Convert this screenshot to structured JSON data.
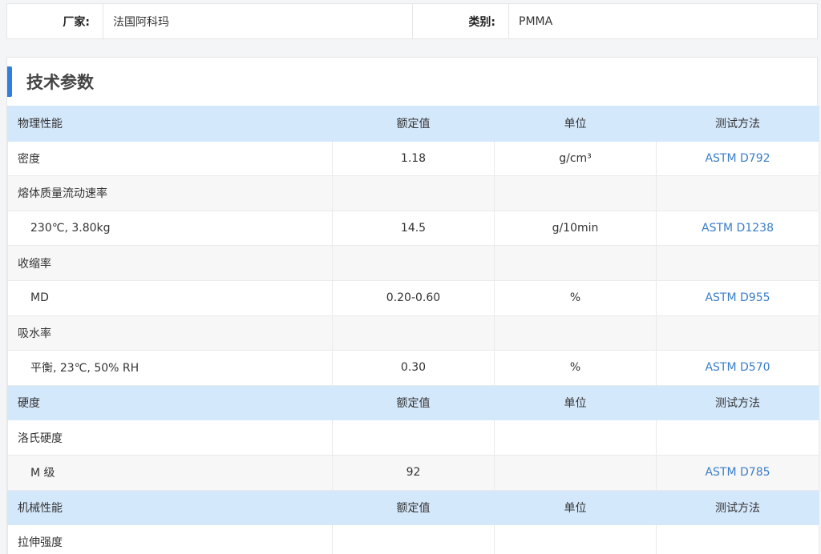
{
  "info": {
    "vendor_label": "厂家:",
    "vendor_value": "法国阿科玛",
    "category_label": "类别:",
    "category_value": "PMMA"
  },
  "panel": {
    "title": "技术参数"
  },
  "columns": {
    "value": "额定值",
    "unit": "单位",
    "method": "测试方法"
  },
  "rows": [
    {
      "type": "header",
      "name": "物理性能"
    },
    {
      "type": "data",
      "name": "密度",
      "value": "1.18",
      "unit": "g/cm³",
      "method": "ASTM D792",
      "bg": "white"
    },
    {
      "type": "data",
      "name": "熔体质量流动速率",
      "value": "",
      "unit": "",
      "method": "",
      "bg": "alt"
    },
    {
      "type": "data",
      "name": "230℃, 3.80kg",
      "value": "14.5",
      "unit": "g/10min",
      "method": "ASTM D1238",
      "bg": "white",
      "sub": true
    },
    {
      "type": "data",
      "name": "收缩率",
      "value": "",
      "unit": "",
      "method": "",
      "bg": "alt"
    },
    {
      "type": "data",
      "name": "MD",
      "value": "0.20-0.60",
      "unit": "%",
      "method": "ASTM D955",
      "bg": "white",
      "sub": true
    },
    {
      "type": "data",
      "name": "吸水率",
      "value": "",
      "unit": "",
      "method": "",
      "bg": "alt"
    },
    {
      "type": "data",
      "name": "平衡, 23℃, 50% RH",
      "value": "0.30",
      "unit": "%",
      "method": "ASTM D570",
      "bg": "white",
      "sub": true
    },
    {
      "type": "header",
      "name": "硬度"
    },
    {
      "type": "data",
      "name": "洛氏硬度",
      "value": "",
      "unit": "",
      "method": "",
      "bg": "white"
    },
    {
      "type": "data",
      "name": "M 级",
      "value": "92",
      "unit": "",
      "method": "ASTM D785",
      "bg": "alt",
      "sub": true
    },
    {
      "type": "header",
      "name": "机械性能"
    },
    {
      "type": "data",
      "name": "拉伸强度",
      "value": "",
      "unit": "",
      "method": "",
      "bg": "white"
    }
  ]
}
